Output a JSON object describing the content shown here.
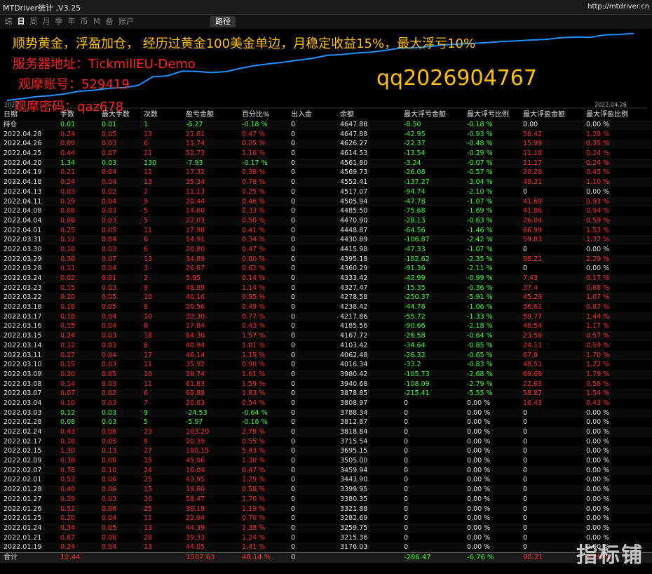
{
  "window": {
    "title": "MTDriver统计 ,V3.25",
    "url": "http://mtdriver.cn"
  },
  "toolbar": {
    "tabs": [
      "综",
      "日",
      "周",
      "月",
      "季",
      "年",
      "币",
      "M",
      "备",
      "账户"
    ],
    "active_index": 1,
    "route_label": "路径"
  },
  "chart": {
    "start_date": "2022",
    "end_date": "2022.04.28"
  },
  "overlay": {
    "line1": "顺势黄金，浮盈加仓， 经历过黄金100美金单边，月稳定收益15%，最大浮亏10%",
    "line2": "服务器地址：TickmillEU-Demo",
    "line3": "观摩账号：529419",
    "line4": "观摩密码：qaz678",
    "qq": "qq2026904767"
  },
  "table": {
    "columns": [
      "日期",
      "手数",
      "最大手数",
      "次数",
      "盈亏金额",
      "百分比%",
      "出入金",
      "余额",
      "最大浮亏金额",
      "最大浮亏比例",
      "最大浮盈金额",
      "最大浮盈比例"
    ],
    "rows": [
      [
        "持仓",
        "0.01",
        "0.01",
        "1",
        "-8.27",
        "-0.18 %",
        "0",
        "4647.88",
        "-8.50",
        "-0.18 %",
        "0.00",
        "0.00 %"
      ],
      [
        "2022.04.28",
        "0.24",
        "0.05",
        "13",
        "21.61",
        "0.47 %",
        "0",
        "4647.88",
        "-42.95",
        "-0.93 %",
        "58.42",
        "1.28 %"
      ],
      [
        "2022.04.26",
        "0.09",
        "0.03",
        "6",
        "11.74",
        "0.25 %",
        "0",
        "4626.27",
        "-22.37",
        "-0.48 %",
        "15.99",
        "0.35 %"
      ],
      [
        "2022.04.25",
        "0.44",
        "0.07",
        "21",
        "52.73",
        "1.16 %",
        "0",
        "4614.53",
        "-13.54",
        "-0.29 %",
        "11.18",
        "0.24 %"
      ],
      [
        "2022.04.20",
        "1.34",
        "0.03",
        "130",
        "-7.93",
        "-0.17 %",
        "0",
        "4561.80",
        "-3.24",
        "-0.07 %",
        "11.17",
        "0.24 %"
      ],
      [
        "2022.04.19",
        "0.21",
        "0.04",
        "12",
        "17.32",
        "0.38 %",
        "0",
        "4569.73",
        "-26.08",
        "-0.57 %",
        "20.28",
        "0.45 %"
      ],
      [
        "2022.04.18",
        "0.24",
        "0.04",
        "13",
        "35.34",
        "0.78 %",
        "0",
        "4552.41",
        "-137.27",
        "-3.04 %",
        "49.31",
        "1.10 %"
      ],
      [
        "2022.04.13",
        "0.03",
        "0.02",
        "2",
        "11.13",
        "0.25 %",
        "0",
        "4517.07",
        "-94.74",
        "-2.10 %",
        "0",
        "0.00 %"
      ],
      [
        "2022.04.11",
        "0.19",
        "0.04",
        "9",
        "20.44",
        "0.46 %",
        "0",
        "4505.94",
        "-47.78",
        "-1.07 %",
        "41.69",
        "0.93 %"
      ],
      [
        "2022.04.08",
        "0.08",
        "0.03",
        "5",
        "14.60",
        "0.33 %",
        "0",
        "4485.50",
        "-75.68",
        "-1.69 %",
        "41.86",
        "0.94 %"
      ],
      [
        "2022.04.04",
        "0.08",
        "0.03",
        "5",
        "22.03",
        "0.50 %",
        "0",
        "4470.90",
        "-28.13",
        "-0.63 %",
        "26.04",
        "0.59 %"
      ],
      [
        "2022.04.01",
        "0.25",
        "0.05",
        "11",
        "17.98",
        "0.41 %",
        "0",
        "4448.87",
        "-64.56",
        "-1.46 %",
        "66.99",
        "1.53 %"
      ],
      [
        "2022.03.31",
        "0.12",
        "0.04",
        "6",
        "14.91",
        "0.34 %",
        "0",
        "4430.89",
        "-106.87",
        "-2.42 %",
        "59.83",
        "1.37 %"
      ],
      [
        "2022.03.30",
        "0.10",
        "0.03",
        "6",
        "20.80",
        "0.47 %",
        "0",
        "4415.98",
        "-47.33",
        "-1.07 %",
        "0",
        "0.00 %"
      ],
      [
        "2022.03.29",
        "0.36",
        "0.07",
        "13",
        "34.89",
        "0.80 %",
        "0",
        "4395.18",
        "-102.62",
        "-2.35 %",
        "98.21",
        "2.29 %"
      ],
      [
        "2022.03.28",
        "0.11",
        "0.04",
        "3",
        "26.87",
        "0.62 %",
        "0",
        "4360.29",
        "-91.36",
        "-2.11 %",
        "0",
        "0.00 %"
      ],
      [
        "2022.03.24",
        "0.02",
        "0.01",
        "2",
        "5.85",
        "0.14 %",
        "0",
        "4333.42",
        "-42.99",
        "-0.99 %",
        "7.43",
        "0.17 %"
      ],
      [
        "2022.03.23",
        "0.15",
        "0.03",
        "9",
        "48.89",
        "1.14 %",
        "0",
        "4327.47",
        "-15.35",
        "-0.36 %",
        "37.4",
        "0.88 %"
      ],
      [
        "2022.03.22",
        "0.20",
        "0.05",
        "10",
        "40.16",
        "0.95 %",
        "0",
        "4278.58",
        "-250.37",
        "-5.91 %",
        "45.29",
        "1.07 %"
      ],
      [
        "2022.03.18",
        "0.18",
        "0.05",
        "8",
        "20.56",
        "0.49 %",
        "0",
        "4238.42",
        "-44.78",
        "-1.06 %",
        "36.61",
        "0.87 %"
      ],
      [
        "2022.03.17",
        "0.18",
        "0.04",
        "10",
        "32.30",
        "0.77 %",
        "0",
        "4217.86",
        "-55.72",
        "-1.33 %",
        "59.77",
        "1.44 %"
      ],
      [
        "2022.03.16",
        "0.15",
        "0.04",
        "8",
        "17.84",
        "0.43 %",
        "0",
        "4185.56",
        "-90.66",
        "-2.18 %",
        "48.54",
        "1.17 %"
      ],
      [
        "2022.03.15",
        "0.24",
        "0.03",
        "18",
        "64.30",
        "1.57 %",
        "0",
        "4167.72",
        "-26.58",
        "-0.64 %",
        "23.56",
        "0.57 %"
      ],
      [
        "2022.03.14",
        "0.12",
        "0.03",
        "8",
        "40.94",
        "1.01 %",
        "0",
        "4103.42",
        "-34.64",
        "-0.85 %",
        "24.11",
        "0.59 %"
      ],
      [
        "2022.03.11",
        "0.27",
        "0.04",
        "17",
        "46.14",
        "1.15 %",
        "0",
        "4062.48",
        "-26.32",
        "-0.65 %",
        "67.9",
        "1.70 %"
      ],
      [
        "2022.03.10",
        "0.15",
        "0.03",
        "11",
        "35.92",
        "0.90 %",
        "0",
        "4016.34",
        "-33.2",
        "-0.83 %",
        "48.51",
        "1.22 %"
      ],
      [
        "2022.03.09",
        "0.20",
        "0.05",
        "10",
        "39.74",
        "1.01 %",
        "0",
        "3980.42",
        "-105.73",
        "-2.68 %",
        "69.69",
        "1.79 %"
      ],
      [
        "2022.03.08",
        "0.14",
        "0.03",
        "11",
        "61.83",
        "1.59 %",
        "0",
        "3940.68",
        "-108.09",
        "-2.79 %",
        "22.63",
        "0.58 %"
      ],
      [
        "2022.03.07",
        "0.07",
        "0.02",
        "6",
        "69.88",
        "1.83 %",
        "0",
        "3878.85",
        "-215.41",
        "-5.55 %",
        "58.87",
        "1.54 %"
      ],
      [
        "2022.03.04",
        "0.10",
        "0.03",
        "7",
        "20.63",
        "0.54 %",
        "0",
        "3808.97",
        "0",
        "0.00 %",
        "16.43",
        "0.43 %"
      ],
      [
        "2022.03.03",
        "0.12",
        "0.03",
        "9",
        "-24.53",
        "-0.64 %",
        "0",
        "3788.34",
        "0",
        "0.00 %",
        "0",
        "0.00 %"
      ],
      [
        "2022.02.28",
        "0.08",
        "0.03",
        "5",
        "-5.97",
        "-0.16 %",
        "0",
        "3812.87",
        "0",
        "0.00 %",
        "0",
        "0.00 %"
      ],
      [
        "2022.02.24",
        "0.43",
        "0.06",
        "23",
        "103.20",
        "2.78 %",
        "0",
        "3818.84",
        "0",
        "0.00 %",
        "0",
        "0.00 %"
      ],
      [
        "2022.02.17",
        "0.18",
        "0.05",
        "8",
        "20.39",
        "0.55 %",
        "0",
        "3715.54",
        "0",
        "0.00 %",
        "0",
        "0.00 %"
      ],
      [
        "2022.02.15",
        "1.30",
        "0.13",
        "27",
        "190.15",
        "5.43 %",
        "0",
        "3695.15",
        "0",
        "0.00 %",
        "0",
        "0.00 %"
      ],
      [
        "2022.02.09",
        "0.38",
        "0.06",
        "15",
        "45.06",
        "1.30 %",
        "0",
        "3505.00",
        "0",
        "0.00 %",
        "0",
        "0.00 %"
      ],
      [
        "2022.02.07",
        "0.78",
        "0.10",
        "24",
        "16.04",
        "0.47 %",
        "0",
        "3459.94",
        "0",
        "0.00 %",
        "0",
        "0.00 %"
      ],
      [
        "2022.02.01",
        "0.53",
        "0.06",
        "25",
        "43.95",
        "1.29 %",
        "0",
        "3443.90",
        "0",
        "0.00 %",
        "0",
        "0.00 %"
      ],
      [
        "2022.01.28",
        "0.40",
        "0.06",
        "15",
        "19.60",
        "0.58 %",
        "0",
        "3399.95",
        "0",
        "0.00 %",
        "0",
        "0.00 %"
      ],
      [
        "2022.01.27",
        "0.29",
        "0.03",
        "20",
        "58.47",
        "1.76 %",
        "0",
        "3380.35",
        "0",
        "0.00 %",
        "0",
        "0.00 %"
      ],
      [
        "2022.01.26",
        "0.52",
        "0.06",
        "25",
        "39.19",
        "1.19 %",
        "0",
        "3321.88",
        "0",
        "0.00 %",
        "0",
        "0.00 %"
      ],
      [
        "2022.01.25",
        "0.20",
        "0.04",
        "11",
        "22.94",
        "0.70 %",
        "0",
        "3282.69",
        "0",
        "0.00 %",
        "0",
        "0.00 %"
      ],
      [
        "2022.01.24",
        "0.34",
        "0.05",
        "13",
        "44.39",
        "1.38 %",
        "0",
        "3259.75",
        "0",
        "0.00 %",
        "0",
        "0.00 %"
      ],
      [
        "2022.01.21",
        "0.67",
        "0.06",
        "28",
        "39.33",
        "1.24 %",
        "0",
        "3215.36",
        "0",
        "0.00 %",
        "0",
        "0.00 %"
      ],
      [
        "2022.01.19",
        "0.24",
        "0.04",
        "13",
        "44.05",
        "1.41 %",
        "0",
        "3176.03",
        "0",
        "0.00 %",
        "0",
        "0.00 %"
      ]
    ],
    "total": [
      "合计",
      "12.44",
      "",
      "",
      "1507.63",
      "48.14 %",
      "0",
      "",
      "-286.47",
      "-6.76 %",
      "98.21",
      "2.29 %"
    ]
  },
  "watermark": "指标铺",
  "colors": {
    "profit": "#ff2a2a",
    "loss": "#33ff33",
    "curve": "#1e90ff",
    "highlight": "#ffc000"
  }
}
